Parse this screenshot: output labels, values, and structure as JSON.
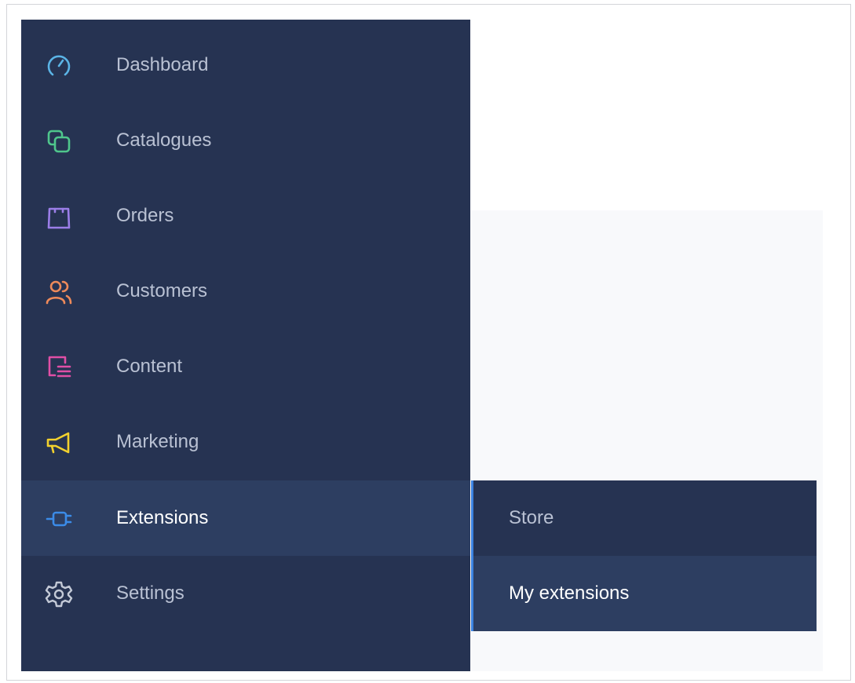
{
  "sidebar": {
    "items": [
      {
        "label": "Dashboard",
        "icon": "gauge-icon",
        "color": "#5bb4e6"
      },
      {
        "label": "Catalogues",
        "icon": "copy-icon",
        "color": "#4fc68c"
      },
      {
        "label": "Orders",
        "icon": "bag-icon",
        "color": "#9b7ee8"
      },
      {
        "label": "Customers",
        "icon": "users-icon",
        "color": "#ee8a5a"
      },
      {
        "label": "Content",
        "icon": "document-list-icon",
        "color": "#e04fa6"
      },
      {
        "label": "Marketing",
        "icon": "megaphone-icon",
        "color": "#f2d12e"
      },
      {
        "label": "Extensions",
        "icon": "plug-icon",
        "color": "#3b8be8",
        "active": true
      },
      {
        "label": "Settings",
        "icon": "gear-icon",
        "color": "#c3c9d6"
      }
    ]
  },
  "submenu": {
    "items": [
      {
        "label": "Store"
      },
      {
        "label": "My extensions",
        "active": true
      }
    ]
  },
  "colors": {
    "sidebar_bg": "#263352",
    "active_bg": "#2d3e61",
    "accent": "#3b82e0"
  }
}
